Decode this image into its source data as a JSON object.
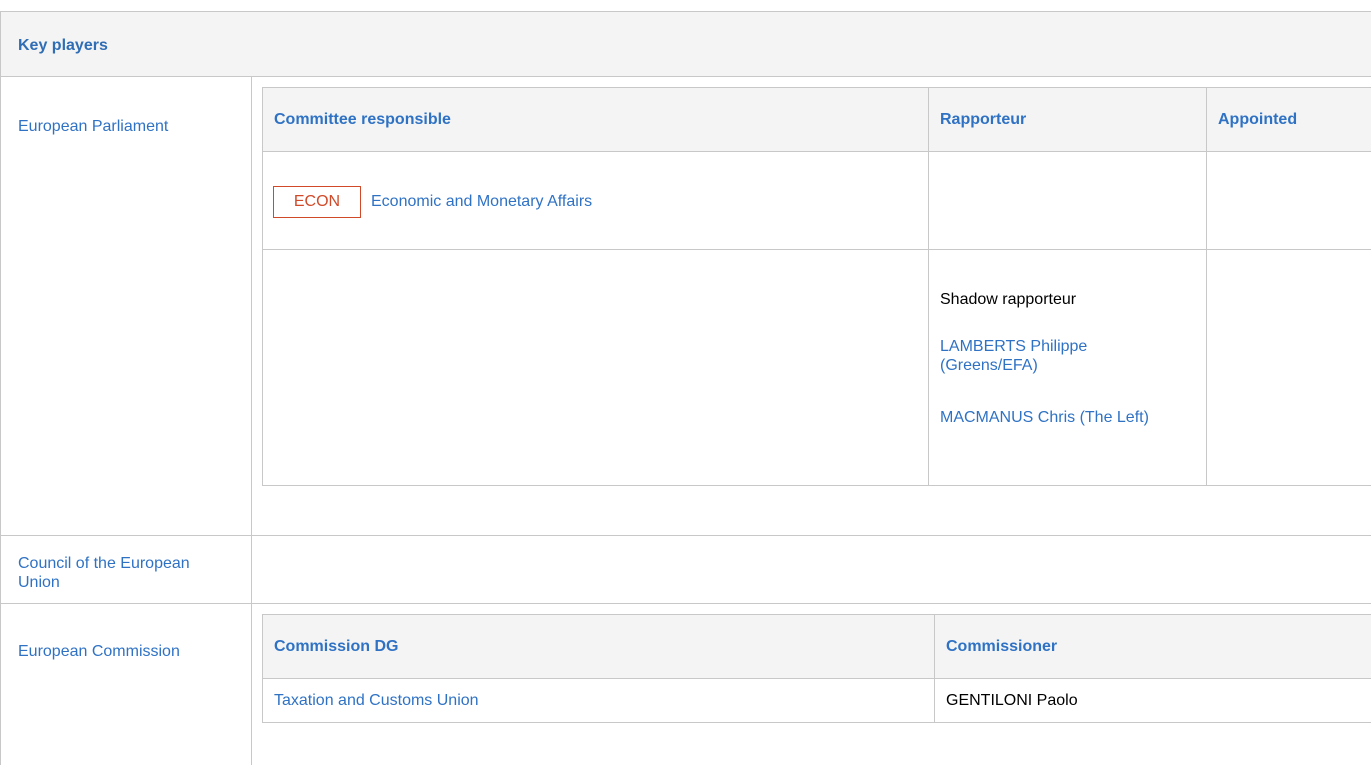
{
  "section": {
    "title": "Key players"
  },
  "rows": {
    "parliament": {
      "label": "European Parliament"
    },
    "council": {
      "label": "Council of the European Union"
    },
    "commission": {
      "label": "European Commission"
    }
  },
  "parliament_table": {
    "headers": {
      "committee": "Committee responsible",
      "rapporteur": "Rapporteur",
      "appointed": "Appointed"
    },
    "committee": {
      "badge": "ECON",
      "name": "Economic and Monetary Affairs"
    },
    "shadow": {
      "label": "Shadow rapporteur",
      "members": [
        "LAMBERTS Philippe (Greens/EFA)",
        "MACMANUS Chris (The Left)"
      ]
    }
  },
  "commission_table": {
    "headers": {
      "dg": "Commission DG",
      "commissioner": "Commissioner"
    },
    "row": {
      "dg": "Taxation and Customs Union",
      "commissioner": "GENTILONI Paolo"
    }
  },
  "colors": {
    "link": "#2f72c4",
    "badge": "#d04a2a",
    "header_bg": "#f4f4f4",
    "border": "#c8c8c8"
  }
}
